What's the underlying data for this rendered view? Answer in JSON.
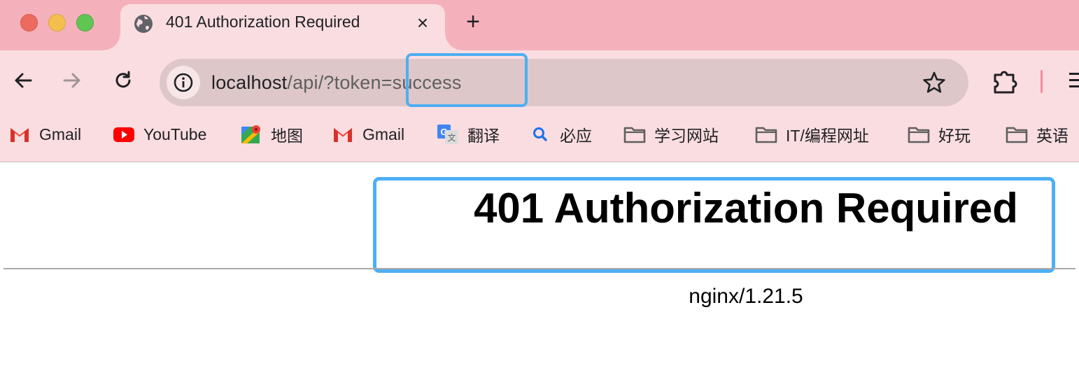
{
  "window": {
    "controls": [
      "close",
      "minimize",
      "maximize"
    ]
  },
  "tab": {
    "title": "401 Authorization Required",
    "close_label": "×",
    "new_tab_label": "+"
  },
  "toolbar": {
    "url_host": "localhost",
    "url_path": "/api/?token=success"
  },
  "bookmarks": [
    {
      "label": "Gmail",
      "icon": "gmail-icon"
    },
    {
      "label": "YouTube",
      "icon": "youtube-icon"
    },
    {
      "label": "地图",
      "icon": "maps-icon"
    },
    {
      "label": "Gmail",
      "icon": "gmail-icon"
    },
    {
      "label": "翻译",
      "icon": "translate-icon"
    },
    {
      "label": "必应",
      "icon": "search-icon"
    },
    {
      "label": "学习网站",
      "icon": "folder-icon"
    },
    {
      "label": "IT/编程网址",
      "icon": "folder-icon"
    },
    {
      "label": "好玩",
      "icon": "folder-icon"
    },
    {
      "label": "英语",
      "icon": "folder-icon"
    }
  ],
  "page": {
    "heading": "401 Authorization Required",
    "server": "nginx/1.21.5"
  },
  "colors": {
    "tabstrip": "#f4b1bb",
    "toolbar": "#fadde1",
    "omnibox": "#dec7c9",
    "highlight": "#4eaef4"
  }
}
